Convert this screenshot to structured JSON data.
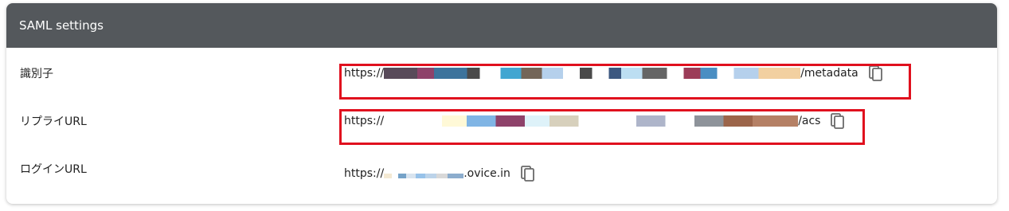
{
  "card": {
    "title": "SAML settings"
  },
  "rows": [
    {
      "label": "識別子",
      "prefix": "https://",
      "suffix": "/metadata",
      "copy_icon": "copy-icon"
    },
    {
      "label": "リプライURL",
      "prefix": "https://",
      "suffix": "/acs",
      "copy_icon": "copy-icon"
    },
    {
      "label": "ログインURL",
      "prefix": "https://",
      "suffix": ".ovice.in",
      "copy_icon": "copy-icon"
    }
  ],
  "colors": {
    "header_bg": "#54585c",
    "highlight": "#e0101e"
  }
}
